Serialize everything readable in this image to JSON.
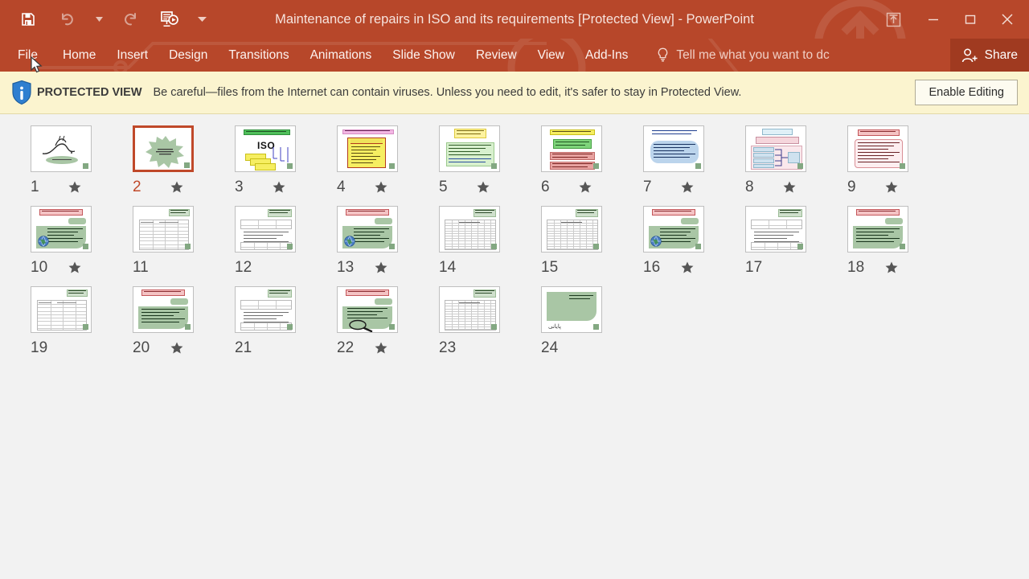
{
  "window": {
    "title": "Maintenance of repairs in ISO and its requirements [Protected View] - PowerPoint",
    "quick_access": [
      {
        "name": "save",
        "icon": "floppy-disk-icon",
        "enabled": true
      },
      {
        "name": "undo",
        "icon": "undo-arrow-icon",
        "enabled": false
      },
      {
        "name": "redo",
        "icon": "redo-arrow-icon",
        "enabled": false
      },
      {
        "name": "start-from-beginning",
        "icon": "slideshow-icon",
        "enabled": true
      },
      {
        "name": "customize-quick-access-toolbar",
        "icon": "chevron-down-icon",
        "enabled": true
      }
    ],
    "controls": {
      "ribbon_display_options": "ribbon-display-options-icon",
      "minimize": "minimize-icon",
      "restore": "restore-icon",
      "close": "close-icon"
    }
  },
  "ribbon": {
    "tabs": [
      {
        "label": "File",
        "active": false
      },
      {
        "label": "Home",
        "active": false
      },
      {
        "label": "Insert",
        "active": false
      },
      {
        "label": "Design",
        "active": false
      },
      {
        "label": "Transitions",
        "active": false
      },
      {
        "label": "Animations",
        "active": false
      },
      {
        "label": "Slide Show",
        "active": false
      },
      {
        "label": "Review",
        "active": false
      },
      {
        "label": "View",
        "active": false
      },
      {
        "label": "Add-Ins",
        "active": false
      }
    ],
    "tell_me_placeholder": "Tell me what you want to dc",
    "share_label": "Share"
  },
  "protected_view": {
    "badge": "PROTECTED VIEW",
    "message": "Be careful—files from the Internet can contain viruses. Unless you need to edit, it's safer to stay in Protected View.",
    "button": "Enable Editing",
    "icon": "info-shield-icon",
    "background_color": "#FBF4CF",
    "border_color": "#E3D9A8"
  },
  "theme": {
    "accent": "#B7472A",
    "accent_dark": "#A03A20",
    "selection": "#C0492A",
    "canvas": "#F2F2F2",
    "slide_green": "#A9C6A5",
    "slide_red": "#E8A2A0",
    "slide_yellow": "#F6EE61",
    "slide_blue": "#BBD4EC"
  },
  "slide_sorter": {
    "slides": [
      {
        "number": "1",
        "starred": true,
        "selected": false,
        "kind": "calligraphy"
      },
      {
        "number": "2",
        "starred": true,
        "selected": true,
        "kind": "burst"
      },
      {
        "number": "3",
        "starred": true,
        "selected": false,
        "kind": "iso"
      },
      {
        "number": "4",
        "starred": true,
        "selected": false,
        "kind": "yellow-box"
      },
      {
        "number": "5",
        "starred": true,
        "selected": false,
        "kind": "quality-policy"
      },
      {
        "number": "6",
        "starred": true,
        "selected": false,
        "kind": "green-red-stack"
      },
      {
        "number": "7",
        "starred": true,
        "selected": false,
        "kind": "blue-rounded"
      },
      {
        "number": "8",
        "starred": true,
        "selected": false,
        "kind": "diagram"
      },
      {
        "number": "9",
        "starred": true,
        "selected": false,
        "kind": "pink-box"
      },
      {
        "number": "10",
        "starred": true,
        "selected": false,
        "kind": "green-photo"
      },
      {
        "number": "11",
        "starred": false,
        "selected": false,
        "kind": "table-wide"
      },
      {
        "number": "12",
        "starred": false,
        "selected": false,
        "kind": "form"
      },
      {
        "number": "13",
        "starred": true,
        "selected": false,
        "kind": "green-photo"
      },
      {
        "number": "14",
        "starred": false,
        "selected": false,
        "kind": "table-dense"
      },
      {
        "number": "15",
        "starred": false,
        "selected": false,
        "kind": "table-dense"
      },
      {
        "number": "16",
        "starred": true,
        "selected": false,
        "kind": "green-photo"
      },
      {
        "number": "17",
        "starred": false,
        "selected": false,
        "kind": "form"
      },
      {
        "number": "18",
        "starred": true,
        "selected": false,
        "kind": "green-plain"
      },
      {
        "number": "19",
        "starred": false,
        "selected": false,
        "kind": "table-wide"
      },
      {
        "number": "20",
        "starred": true,
        "selected": false,
        "kind": "green-plain"
      },
      {
        "number": "21",
        "starred": false,
        "selected": false,
        "kind": "form"
      },
      {
        "number": "22",
        "starred": true,
        "selected": false,
        "kind": "green-magnifier"
      },
      {
        "number": "23",
        "starred": false,
        "selected": false,
        "kind": "table-dense"
      },
      {
        "number": "24",
        "starred": false,
        "selected": false,
        "kind": "thankyou"
      }
    ],
    "thankyou_text": "پایانی"
  }
}
